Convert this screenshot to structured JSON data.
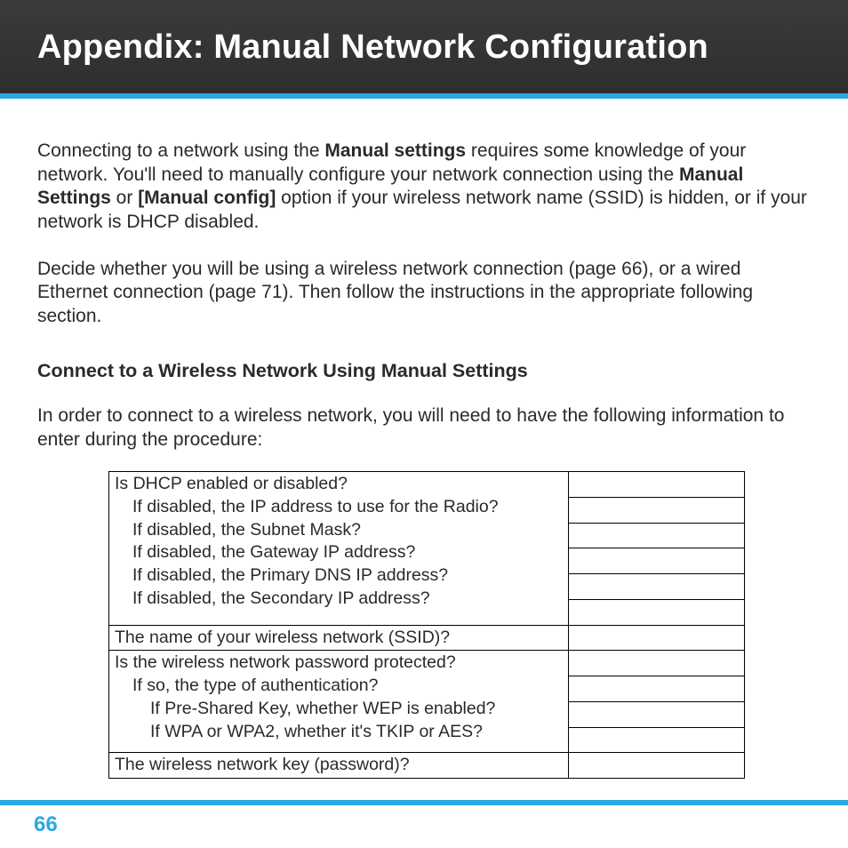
{
  "header": {
    "title": "Appendix: Manual Network Configuration"
  },
  "p1": {
    "t1": "Connecting to a network using the ",
    "b1": "Manual settings",
    "t2": " requires some knowledge of your network. You'll need to manually configure your network connection using the ",
    "b2": "Manual Settings",
    "t3": " or ",
    "b3": "[Manual config]",
    "t4": " option if your wireless network name (SSID) is hidden, or if your network is DHCP disabled."
  },
  "p2": "Decide whether you will be using a wireless network connection (page 66), or a wired Ethernet connection (page 71). Then follow the instructions in the appropriate following section.",
  "section_heading": "Connect to a Wireless Network Using Manual Settings",
  "p3": "In order to connect to a wireless network, you will need to have the following information to enter during the procedure:",
  "table": {
    "r0a": "Is DHCP enabled or disabled?",
    "r0b": "If disabled, the IP address to use for the Radio?",
    "r0c": "If disabled, the Subnet Mask?",
    "r0d": "If disabled, the Gateway IP address?",
    "r0e": "If disabled, the Primary DNS IP address?",
    "r0f": "If disabled, the Secondary IP address?",
    "r1": "The name of your wireless network (SSID)?",
    "r2a": "Is the wireless network password protected?",
    "r2b": "If so, the type of authentication?",
    "r2c": "If Pre-Shared Key, whether WEP is enabled?",
    "r2d": "If WPA or WPA2, whether it's TKIP or AES?",
    "r3": "The wireless network key (password)?"
  },
  "footer": {
    "page": "66"
  }
}
